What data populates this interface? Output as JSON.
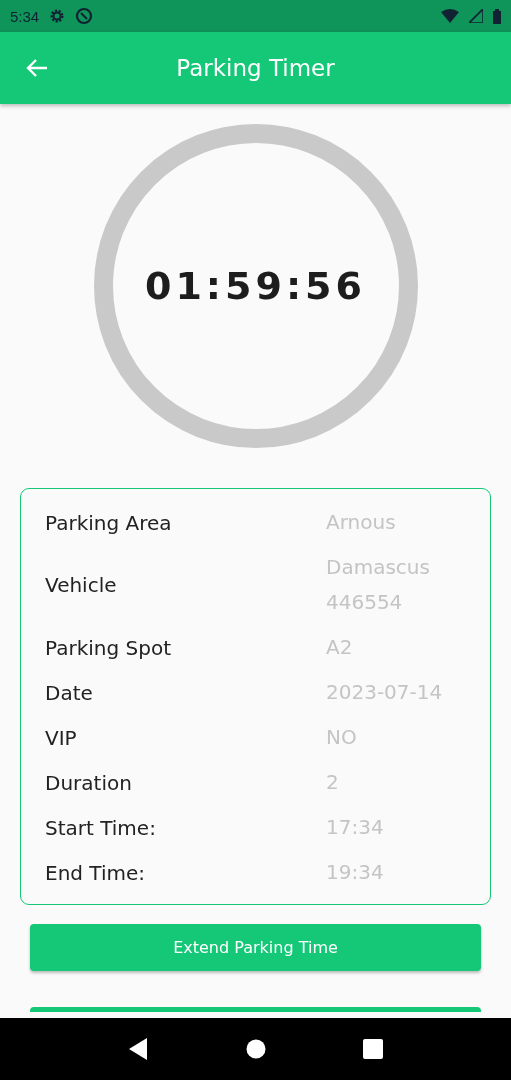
{
  "status_bar": {
    "time": "5:34"
  },
  "app_bar": {
    "title": "Parking Timer"
  },
  "timer": {
    "remaining": "01:59:56"
  },
  "details": [
    {
      "label": "Parking Area",
      "value": "Arnous"
    },
    {
      "label": "Vehicle",
      "value": "Damascus 446554"
    },
    {
      "label": "Parking Spot",
      "value": "A2"
    },
    {
      "label": "Date",
      "value": "2023-07-14"
    },
    {
      "label": "VIP",
      "value": "NO"
    },
    {
      "label": "Duration",
      "value": "2"
    },
    {
      "label": "Start Time:",
      "value": "17:34"
    },
    {
      "label": "End Time:",
      "value": "19:34"
    }
  ],
  "buttons": [
    {
      "label": "Extend Parking Time"
    },
    {
      "kind": "cut"
    }
  ]
}
